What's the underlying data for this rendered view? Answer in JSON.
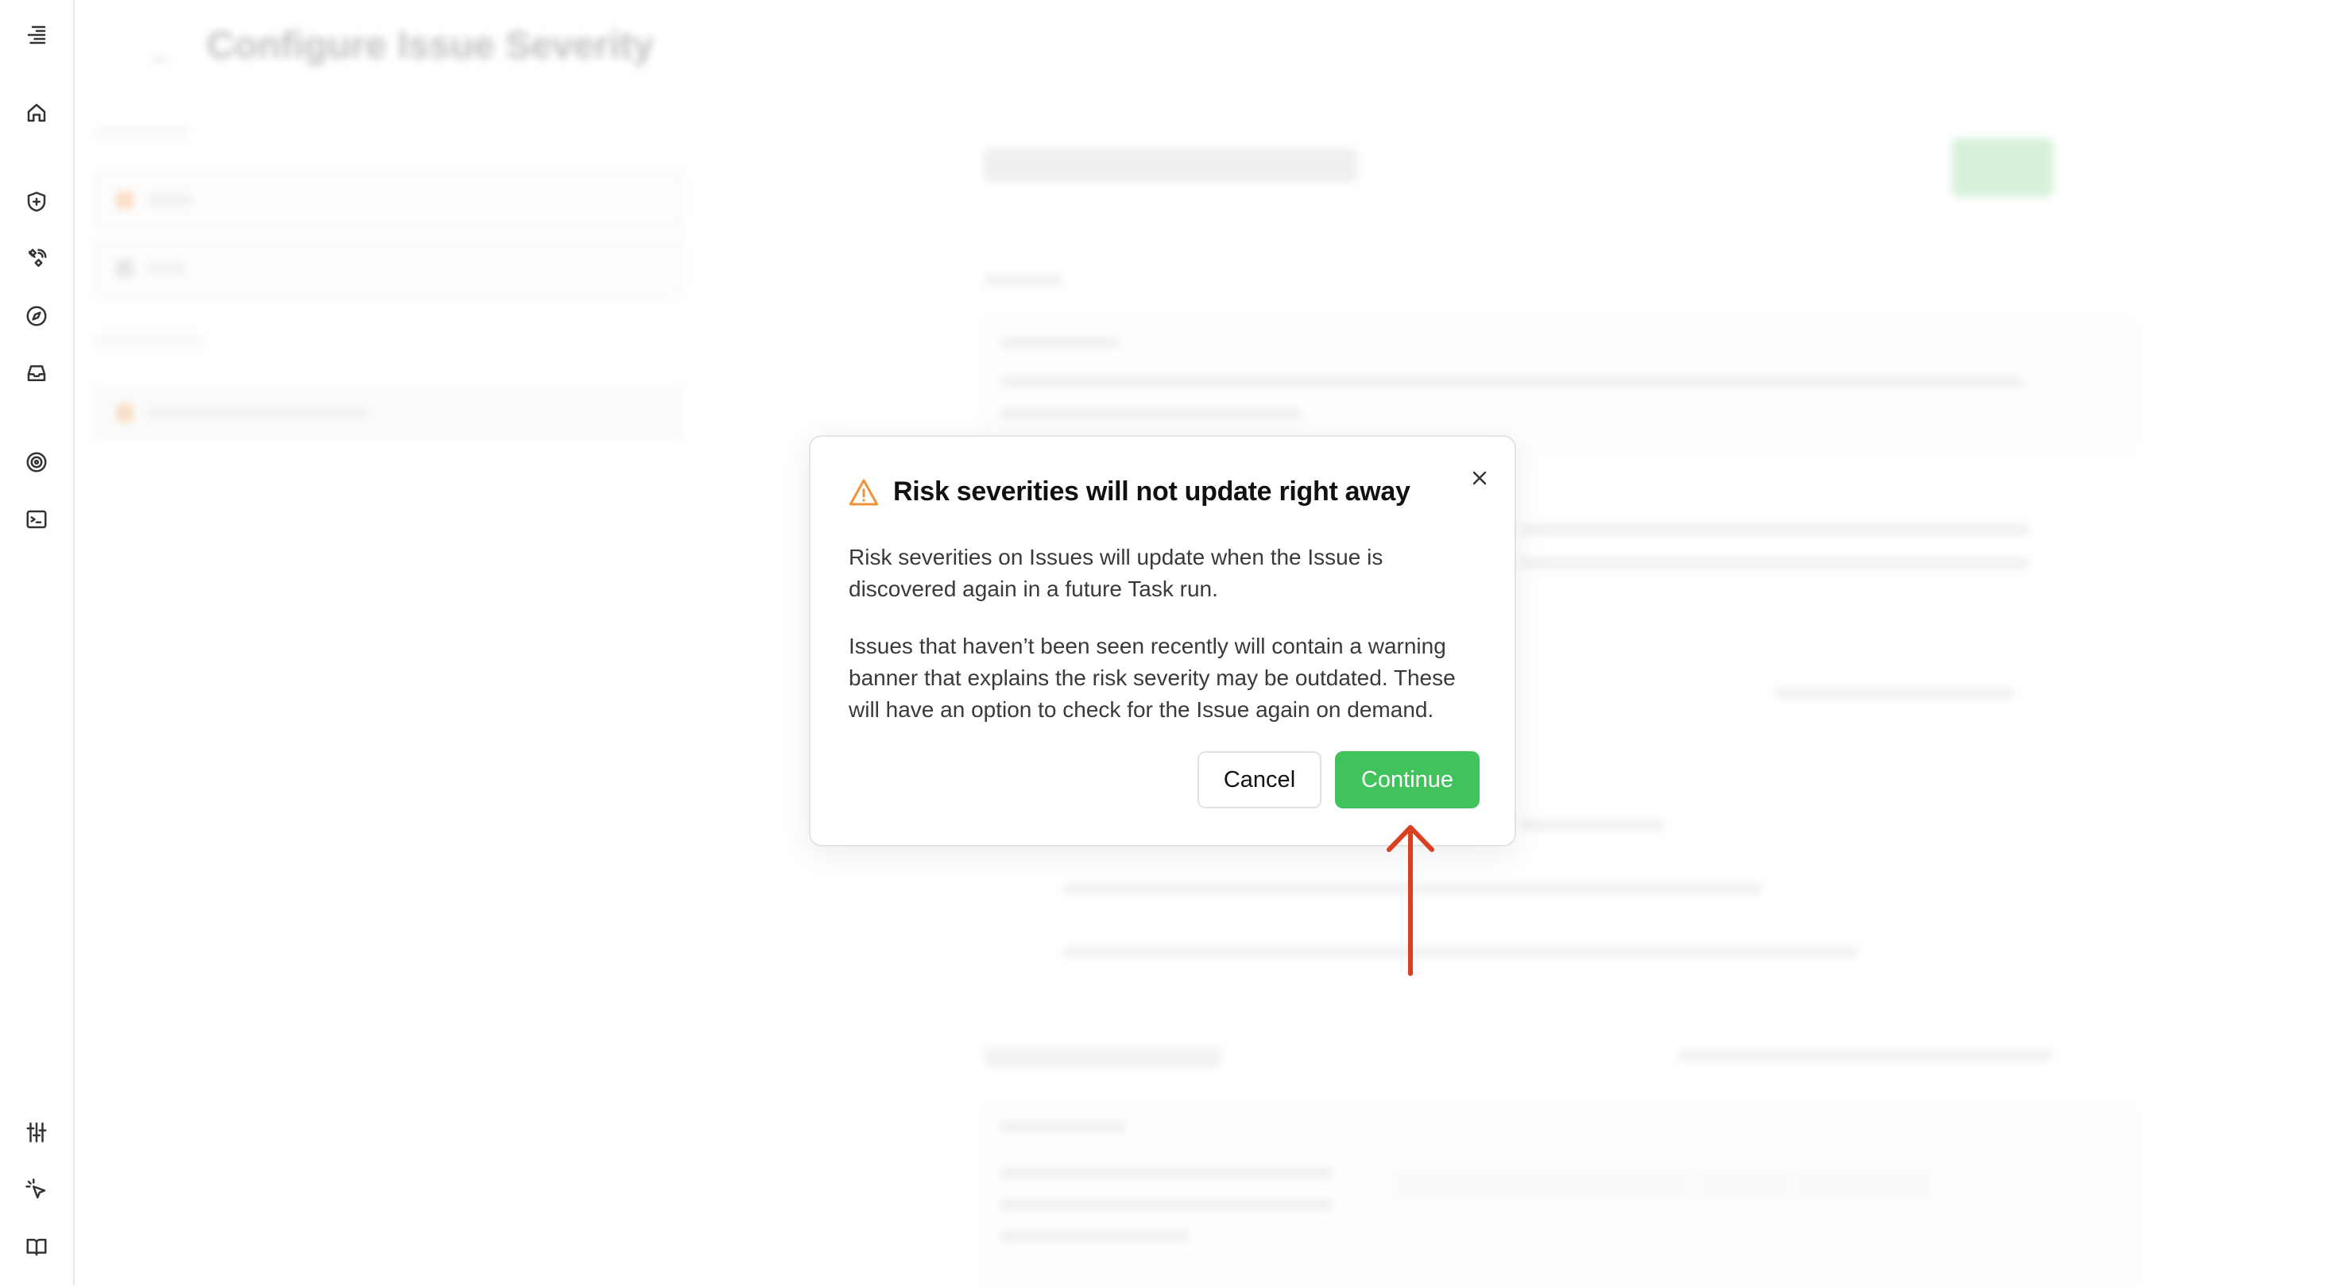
{
  "background_page": {
    "back_glyph": "←",
    "title": "Configure Issue Severity"
  },
  "modal": {
    "title": "Risk severities will not update right away",
    "paragraph_1": "Risk severities on Issues will update when the Issue is discovered again in a future Task run.",
    "paragraph_2": "Issues that haven’t been seen recently will contain a warning banner that explains the risk severity may be outdated. These will have an option to check for the Issue again on demand.",
    "cancel_label": "Cancel",
    "continue_label": "Continue"
  },
  "colors": {
    "accent_green": "#3fc35a",
    "warning_orange": "#f0923a",
    "annotation_red": "#d9401f"
  },
  "icons": {
    "rail": [
      "logo-icon",
      "home-icon",
      "shield-icon",
      "satellite-icon",
      "compass-icon",
      "inbox-icon",
      "target-icon",
      "terminal-icon",
      "sliders-icon",
      "cursor-click-icon",
      "book-icon"
    ]
  }
}
